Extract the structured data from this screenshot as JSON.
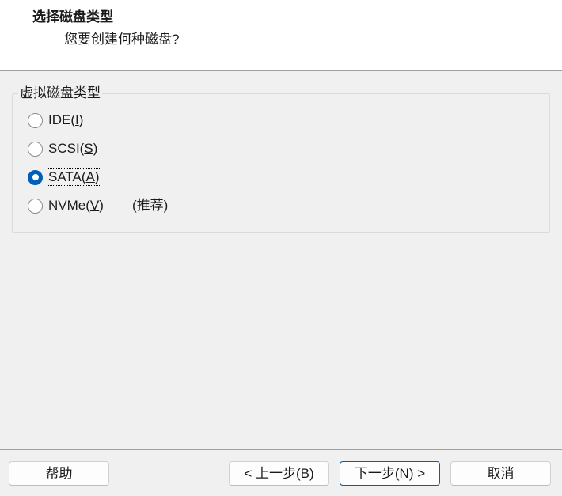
{
  "header": {
    "title": "选择磁盘类型",
    "subtitle": "您要创建何种磁盘?"
  },
  "disk_type_group": {
    "label": "虚拟磁盘类型",
    "options": [
      {
        "prefix": "IDE(",
        "key": "I",
        "suffix": ")",
        "selected": false
      },
      {
        "prefix": "SCSI(",
        "key": "S",
        "suffix": ")",
        "selected": false
      },
      {
        "prefix": "SATA(",
        "key": "A",
        "suffix": ")",
        "selected": true,
        "focused": true
      },
      {
        "prefix": "NVMe(",
        "key": "V",
        "suffix": ")",
        "note": "(推荐)",
        "selected": false
      }
    ]
  },
  "buttons": {
    "help": {
      "label": "帮助"
    },
    "back": {
      "prefix": "< 上一步(",
      "key": "B",
      "suffix": ")"
    },
    "next": {
      "prefix": "下一步(",
      "key": "N",
      "suffix": ") >"
    },
    "cancel": {
      "label": "取消"
    }
  },
  "colors": {
    "accent": "#005fb8",
    "header_background": "#ffffff",
    "dialog_background": "#f0f0f0"
  }
}
